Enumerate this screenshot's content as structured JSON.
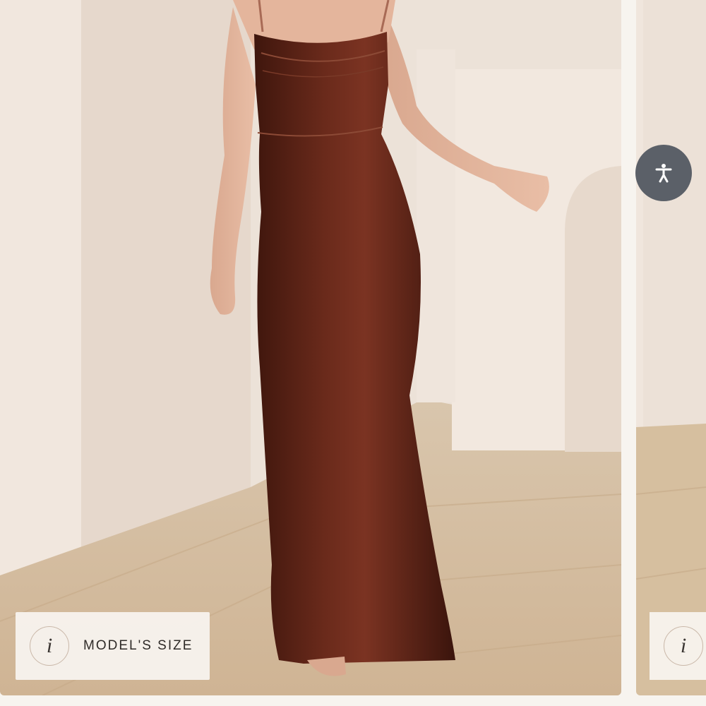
{
  "badges": {
    "model_size_label": "MODEL'S SIZE",
    "info_glyph": "i"
  },
  "controls": {
    "accessibility_icon": "accessibility-icon"
  },
  "colors": {
    "dress": "#5a2317",
    "wall": "#eadfd4",
    "floor": "#d8c2a6",
    "accessibility_bg": "#5b6068"
  }
}
